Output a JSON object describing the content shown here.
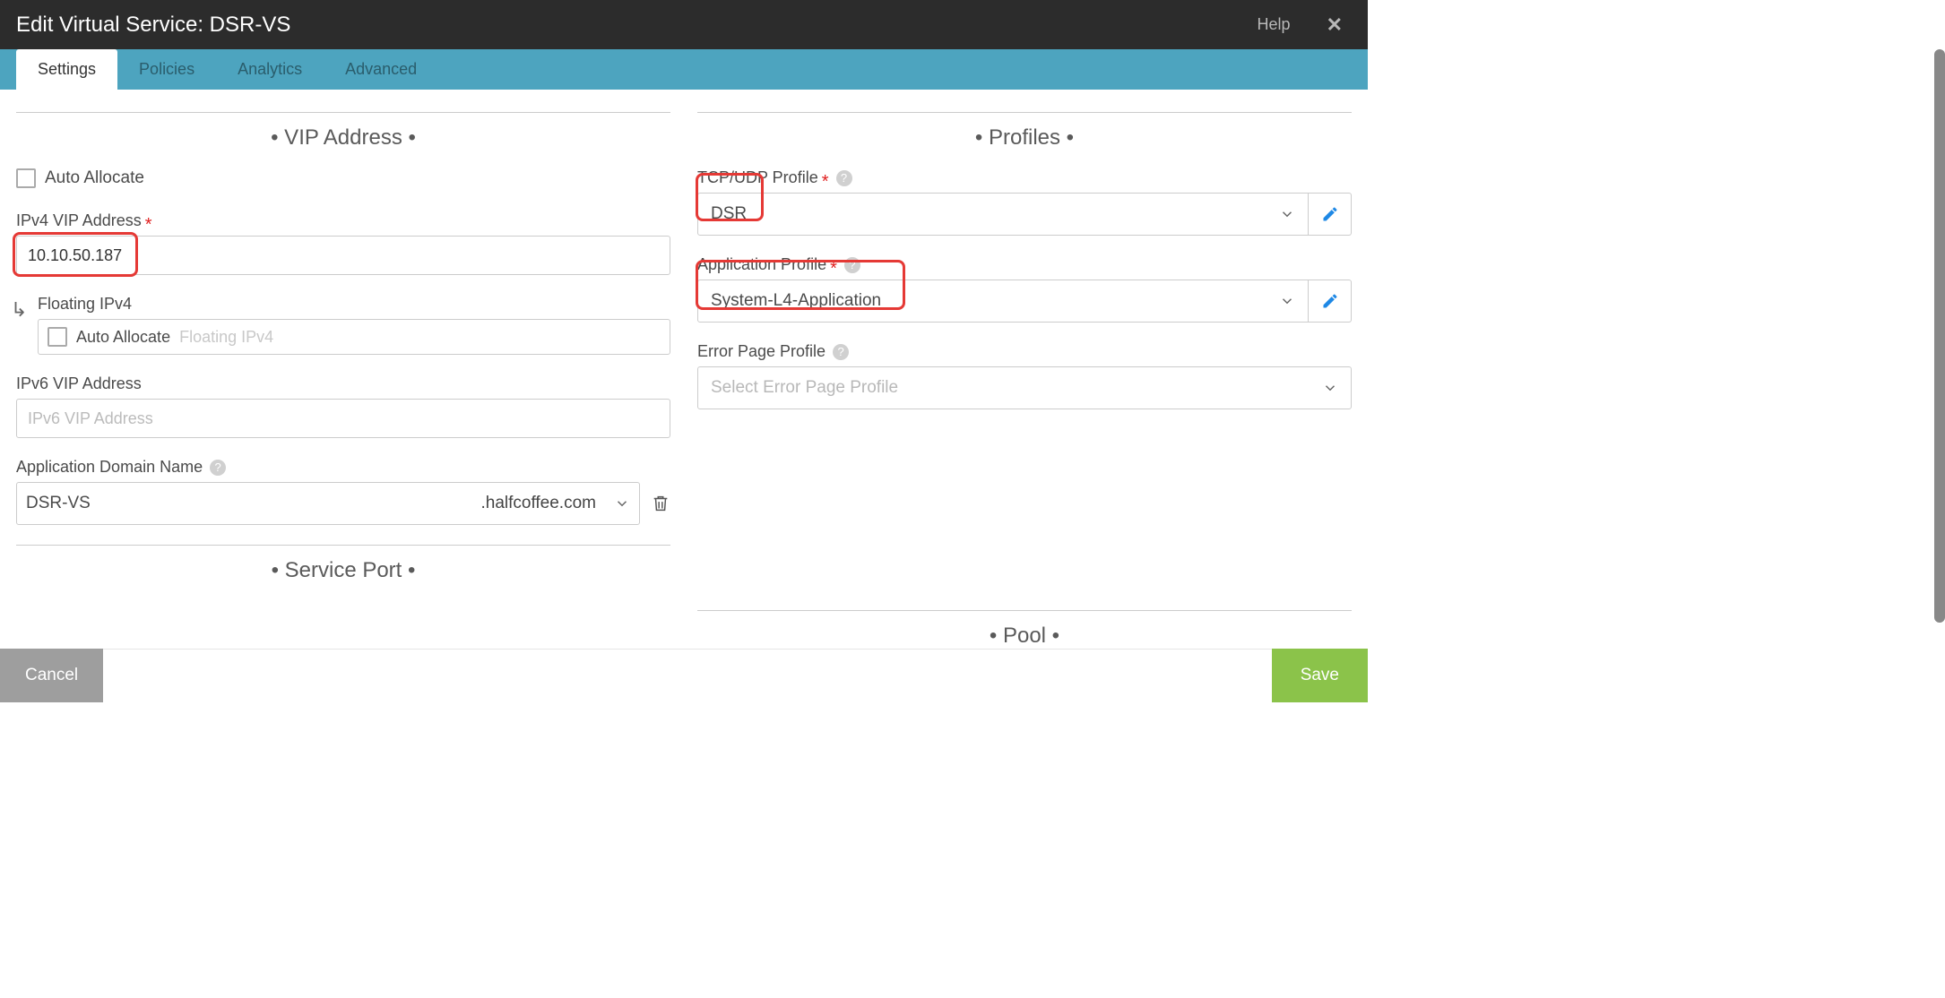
{
  "header": {
    "title": "Edit Virtual Service: DSR-VS",
    "help": "Help"
  },
  "tabs": [
    {
      "label": "Settings",
      "active": true
    },
    {
      "label": "Policies",
      "active": false
    },
    {
      "label": "Analytics",
      "active": false
    },
    {
      "label": "Advanced",
      "active": false
    }
  ],
  "vip": {
    "section_title": "•  VIP Address  •",
    "auto_allocate_label": "Auto Allocate",
    "ipv4_label": "IPv4 VIP Address",
    "ipv4_value": "10.10.50.187",
    "floating_label": "Floating IPv4",
    "floating_auto_allocate_label": "Auto Allocate",
    "floating_placeholder": "Floating IPv4",
    "ipv6_label": "IPv6 VIP Address",
    "ipv6_placeholder": "IPv6 VIP Address",
    "domain_label": "Application Domain Name",
    "domain_value": "DSR-VS",
    "domain_suffix": ".halfcoffee.com"
  },
  "profiles": {
    "section_title": "•  Profiles  •",
    "tcp_label": "TCP/UDP Profile",
    "tcp_value": "DSR",
    "app_label": "Application Profile",
    "app_value": "System-L4-Application",
    "error_label": "Error Page Profile",
    "error_placeholder": "Select Error Page Profile"
  },
  "service_port": {
    "section_title": "•  Service Port  •"
  },
  "pool": {
    "section_title": "•  Pool  •"
  },
  "footer": {
    "cancel": "Cancel",
    "save": "Save"
  }
}
